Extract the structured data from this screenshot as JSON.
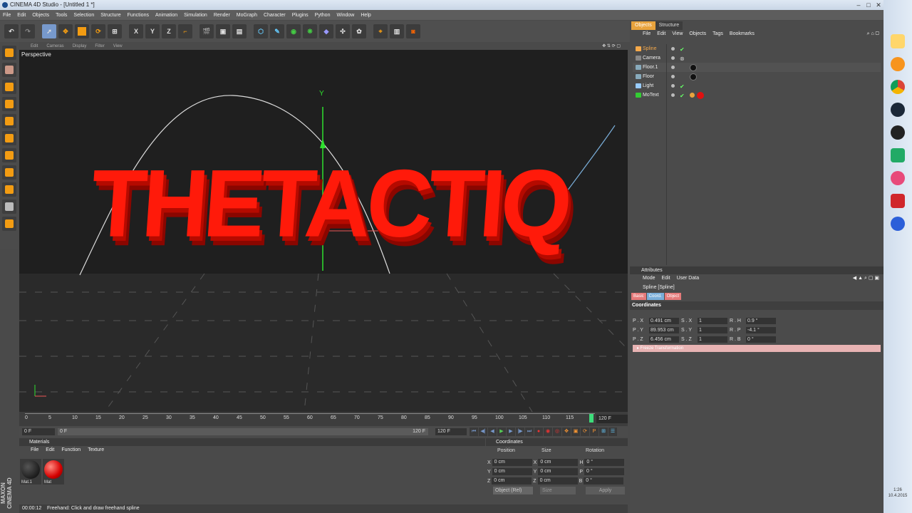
{
  "window": {
    "title": "CINEMA 4D Studio - [Untitled 1 *]",
    "controls": [
      "–",
      "□",
      "✕"
    ]
  },
  "menubar": [
    "File",
    "Edit",
    "Objects",
    "Tools",
    "Selection",
    "Structure",
    "Functions",
    "Animation",
    "Simulation",
    "Render",
    "MoGraph",
    "Character",
    "Plugins",
    "Python",
    "Window",
    "Help"
  ],
  "toolbar": {
    "axis_x": "X",
    "axis_y": "Y",
    "axis_z": "Z"
  },
  "viewport": {
    "menu": [
      "Edit",
      "Cameras",
      "Display",
      "Filter",
      "View"
    ],
    "label": "Perspective",
    "scene_text": "THETACTIQ",
    "text_color": "#ff1a0a"
  },
  "timeline": {
    "ticks": [
      "0",
      "5",
      "10",
      "15",
      "20",
      "25",
      "30",
      "35",
      "40",
      "45",
      "50",
      "55",
      "60",
      "65",
      "70",
      "75",
      "80",
      "85",
      "90",
      "95",
      "100",
      "105",
      "110",
      "115"
    ],
    "current_frame": "120 F",
    "start_field": "0 F",
    "range_start": "0 F",
    "range_end": "120 F",
    "end_field": "120 F"
  },
  "materials": {
    "title": "Materials",
    "menu": [
      "File",
      "Edit",
      "Function",
      "Texture"
    ],
    "items": [
      {
        "name": "Mat.1",
        "color": "#111111"
      },
      {
        "name": "Mat",
        "color": "#e01010"
      }
    ]
  },
  "coordinates": {
    "title": "Coordinates",
    "headers": [
      "Position",
      "Size",
      "Rotation"
    ],
    "rows": [
      {
        "axis": "X",
        "pos": "0 cm",
        "size": "0 cm",
        "rot_axis": "H",
        "rot": "0 °"
      },
      {
        "axis": "Y",
        "pos": "0 cm",
        "size": "0 cm",
        "rot_axis": "P",
        "rot": "0 °"
      },
      {
        "axis": "Z",
        "pos": "0 cm",
        "size": "0 cm",
        "rot_axis": "B",
        "rot": "0 °"
      }
    ],
    "mode": "Object (Rel)",
    "size_mode": "Size",
    "apply": "Apply"
  },
  "status": {
    "time": "00:00:12",
    "message": "Freehand: Click and draw freehand spline"
  },
  "logo": "MAXON CINEMA 4D",
  "object_manager": {
    "tabs": [
      "Objects",
      "Structure"
    ],
    "menu": [
      "File",
      "Edit",
      "View",
      "Objects",
      "Tags",
      "Bookmarks"
    ],
    "objects": [
      {
        "name": "Spline",
        "selected": true
      },
      {
        "name": "Camera",
        "selected": false
      },
      {
        "name": "Floor.1",
        "selected": false
      },
      {
        "name": "Floor",
        "selected": false
      },
      {
        "name": "Light",
        "selected": false
      },
      {
        "name": "MoText",
        "selected": false
      }
    ]
  },
  "attributes": {
    "title": "Attributes",
    "menu": [
      "Mode",
      "Edit",
      "User Data"
    ],
    "object": "Spline [Spline]",
    "tabs": [
      "Basic",
      "Coord.",
      "Object"
    ],
    "section": "Coordinates",
    "rows": [
      {
        "p_label": "P . X",
        "p_val": "0.491 cm",
        "s_label": "S . X",
        "s_val": "1",
        "r_label": "R . H",
        "r_val": "0.9 °"
      },
      {
        "p_label": "P . Y",
        "p_val": "89.953 cm",
        "s_label": "S . Y",
        "s_val": "1",
        "r_label": "R . P",
        "r_val": "-4.1 °"
      },
      {
        "p_label": "P . Z",
        "p_val": "6.456 cm",
        "s_label": "S . Z",
        "s_val": "1",
        "r_label": "R . B",
        "r_val": "0 °"
      }
    ],
    "freeze": "▸ Freeze Transformation"
  },
  "taskbar": {
    "time": "1:26",
    "date": "10.4.2015"
  }
}
